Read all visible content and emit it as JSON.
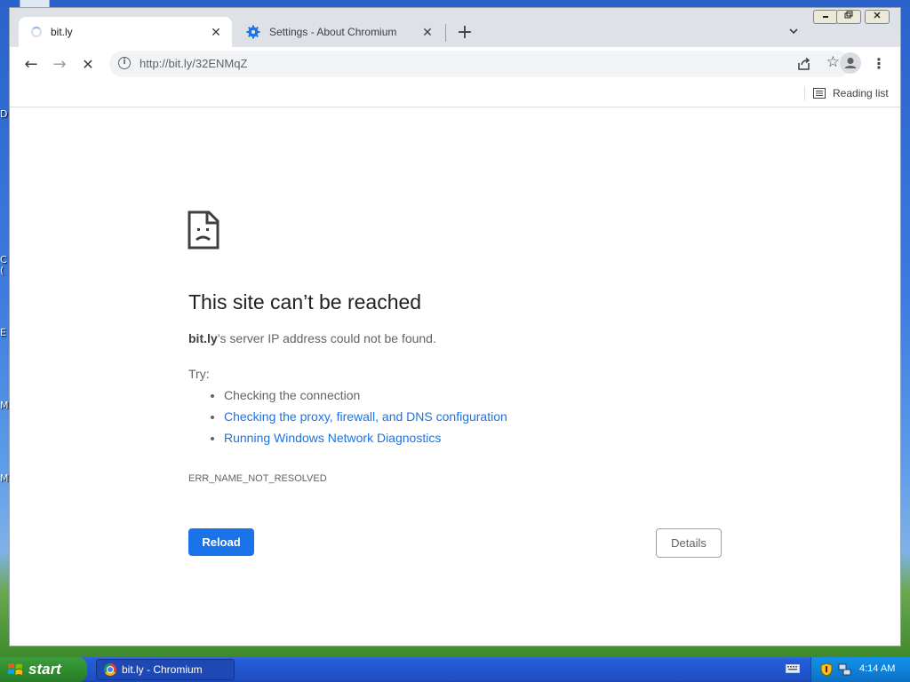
{
  "desktop": {
    "edge_letters": [
      "D",
      "C",
      "(",
      "E",
      "M",
      "M"
    ]
  },
  "browser": {
    "tabs": [
      {
        "title": "bit.ly",
        "active": true
      },
      {
        "title": "Settings - About Chromium",
        "active": false
      }
    ],
    "new_tab_label": "+",
    "tab_search_label": "⌄",
    "window_controls": {
      "minimize": "▭",
      "restore": "❐",
      "close": "✕"
    },
    "toolbar": {
      "back": "←",
      "forward": "→",
      "stop": "✕",
      "url": "http://bit.ly/32ENMqZ",
      "bookmark_star": "☆",
      "menu": "⋮"
    },
    "bookmarks_bar": {
      "reading_list_label": "Reading list"
    }
  },
  "error_page": {
    "headline": "This site can’t be reached",
    "host": "bit.ly",
    "message": "’s server IP address could not be found.",
    "try_label": "Try:",
    "suggestions": [
      {
        "text": "Checking the connection",
        "link": false
      },
      {
        "text": "Checking the proxy, firewall, and DNS configuration",
        "link": true
      },
      {
        "text": "Running Windows Network Diagnostics",
        "link": true
      }
    ],
    "error_code": "ERR_NAME_NOT_RESOLVED",
    "reload_label": "Reload",
    "details_label": "Details"
  },
  "taskbar": {
    "start_label": "start",
    "task_item_label": "bit.ly - Chromium",
    "clock": "4:14 AM"
  },
  "colors": {
    "link": "#1a73e8",
    "primary_button": "#1a73e8",
    "taskbar_blue": "#245edb",
    "start_green": "#2f8f2f"
  },
  "icons": {
    "tab_loading": "spinner-icon",
    "settings_tab": "gear-icon",
    "site_info": "info-icon",
    "share": "share-icon",
    "profile": "profile-icon",
    "reading_list": "reading-list-icon",
    "error": "sad-page-icon",
    "tray": [
      "security-shield-icon",
      "network-icon"
    ]
  }
}
